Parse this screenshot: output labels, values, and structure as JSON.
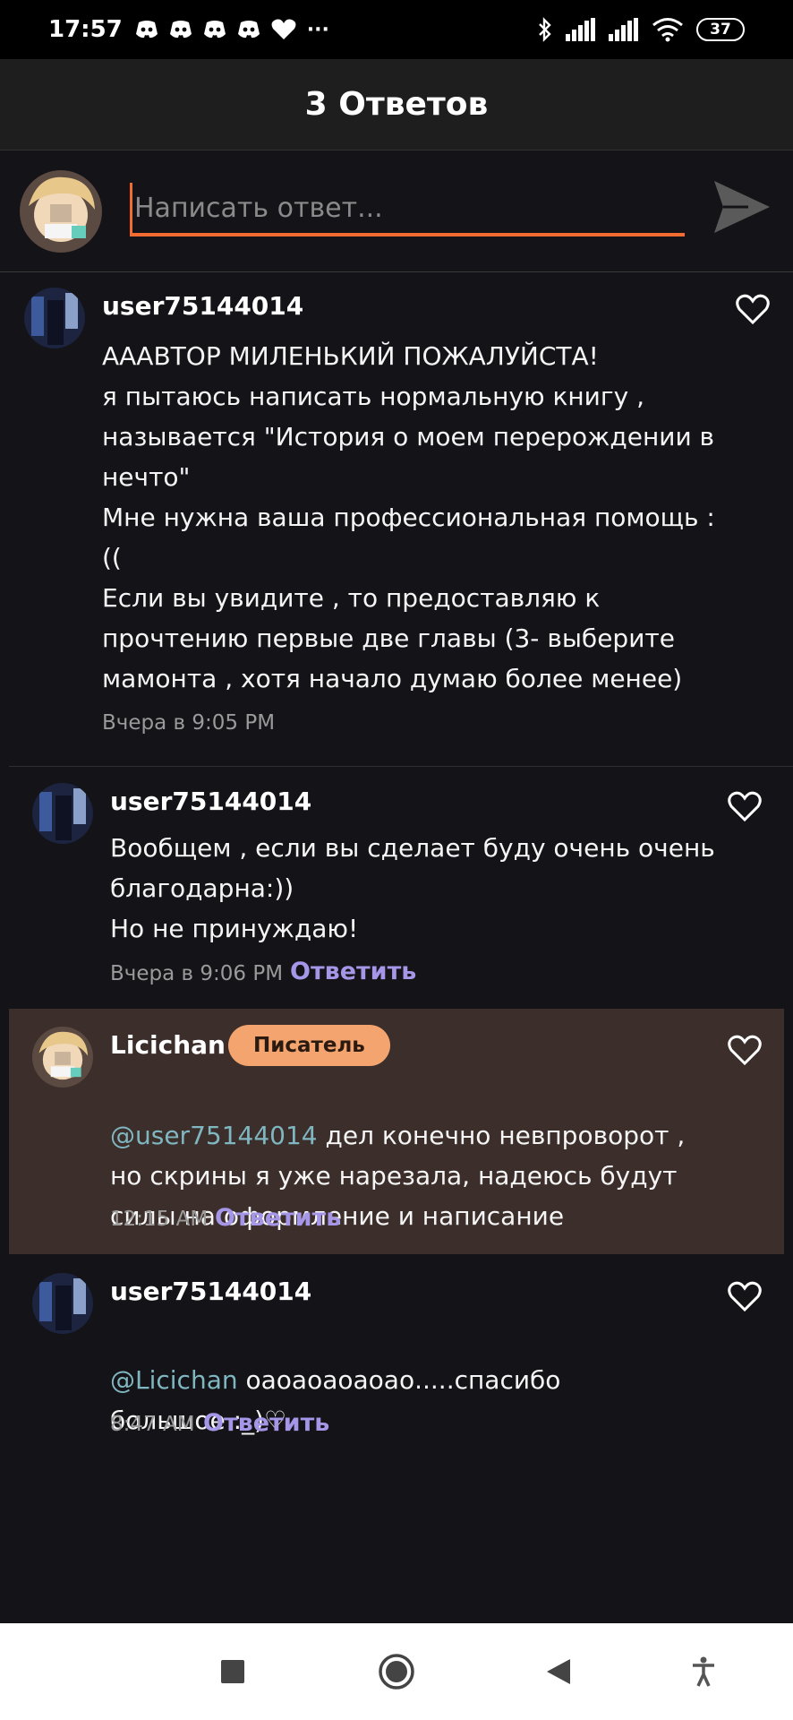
{
  "status": {
    "time": "17:57",
    "battery": "37",
    "more": "···"
  },
  "header": {
    "title": "3 Ответов"
  },
  "reply": {
    "placeholder": "Написать ответ..."
  },
  "comments": [
    {
      "username": "user75144014",
      "text": "АААВТОР МИЛЕНЬКИЙ ПОЖАЛУЙСТА!\nя пытаюсь написать нормальную книгу ,\nназывается \"История о моем перерождении в\nнечто\"\nМне нужна ваша профессиональная  помощь :\n((\nЕсли вы увидите , то предоставляю к\nпрочтению первые две главы (3- выберите\nмамонта , хотя начало думаю более менее)",
      "time": "Вчера в 9:05 PM"
    },
    {
      "username": "user75144014",
      "text": "Вообщем , если вы сделает буду очень очень\nблагодарна:))\nНо не принуждаю!",
      "time": "Вчера в 9:06 PM",
      "reply_label": "Ответить"
    },
    {
      "username": "Licichan",
      "badge": "Писатель",
      "mention": "@user75144014",
      "text_first": " дел конечно невпроворот ,",
      "text_rest": "но скрины я уже нарезала, надеюсь будут\nсилы на оформление и написание",
      "time": "12:15 AM",
      "reply_label": "Ответить",
      "highlight_color": "#3b2e2b"
    },
    {
      "username": "user75144014",
      "mention": "@Licichan",
      "text_first": " оаоаоаоаоао.....спасибо",
      "text_rest": "большое :_)♡",
      "time": "8:47 AM",
      "reply_label": "Ответить"
    }
  ],
  "icons": {
    "send": "send-icon",
    "like": "heart-outline-icon",
    "nav": [
      "square-icon",
      "home-circle-icon",
      "back-triangle-icon",
      "accessibility-icon"
    ]
  },
  "colors": {
    "accent": "#f26b31",
    "link": "#a596e8",
    "mention": "#7fb6c0",
    "badge": "#f4a46e"
  }
}
